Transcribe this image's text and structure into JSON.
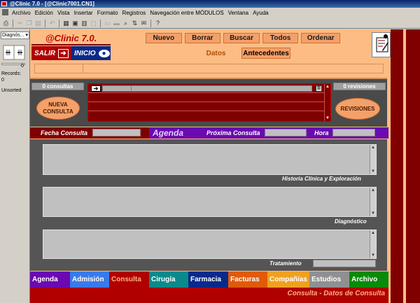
{
  "window": {
    "title": "@Clinic 7.0 - [@Clinic7001.CN1]"
  },
  "menu": [
    "Archivo",
    "Edición",
    "Vista",
    "Insertar",
    "Formato",
    "Registros",
    "Navegación entre MÓDULOS",
    "Ventana",
    "Ayuda"
  ],
  "status_area": {
    "layout_selector": "Diagnós...",
    "record_number": "0",
    "records_label": "Records:",
    "records_count": "0",
    "sort_state": "Unsorted"
  },
  "app": {
    "logo": "@Clinic 7.0.",
    "salir_label": "SALIR",
    "inicio_label": "INICIO"
  },
  "actions": {
    "nuevo": "Nuevo",
    "borrar": "Borrar",
    "buscar": "Buscar",
    "todos": "Todos",
    "ordenar": "Ordenar"
  },
  "tabs": {
    "datos": "Datos",
    "antecedentes": "Antecedentes"
  },
  "consultas": {
    "count_label": "0 consultas",
    "nueva_label": "NUEVA CONSULTA"
  },
  "revisiones": {
    "count_label": "0 revisiones",
    "button_label": "REVISIONES"
  },
  "fields": {
    "fecha_consulta": "Fecha Consulta",
    "agenda": "Agenda",
    "proxima_consulta": "Próxima Consulta",
    "hora": "Hora"
  },
  "notes": {
    "historia": "Historia Clínica y Exploración",
    "diagnostico": "Diagnóstico",
    "tratamiento": "Tratamiento"
  },
  "modules": [
    {
      "label": "Agenda",
      "bg": "#6a0ab0",
      "fg": "#ffffff"
    },
    {
      "label": "Admisión",
      "bg": "#3a7ae8",
      "fg": "#ffffff"
    },
    {
      "label": "Consulta",
      "bg": "#b00000",
      "fg": "#ffb080"
    },
    {
      "label": "Cirugía",
      "bg": "#0a8a8a",
      "fg": "#ffffff"
    },
    {
      "label": "Farmacia",
      "bg": "#0a2a8a",
      "fg": "#ffffff"
    },
    {
      "label": "Facturas",
      "bg": "#e05a0a",
      "fg": "#ffffff"
    },
    {
      "label": "Compañías",
      "bg": "#f0a020",
      "fg": "#ffffff"
    },
    {
      "label": "Estudios",
      "bg": "#909090",
      "fg": "#ffffff"
    },
    {
      "label": "Archivo",
      "bg": "#0a8a0a",
      "fg": "#ffffff"
    }
  ],
  "footer": {
    "text": "Consulta - Datos de Consulta"
  }
}
